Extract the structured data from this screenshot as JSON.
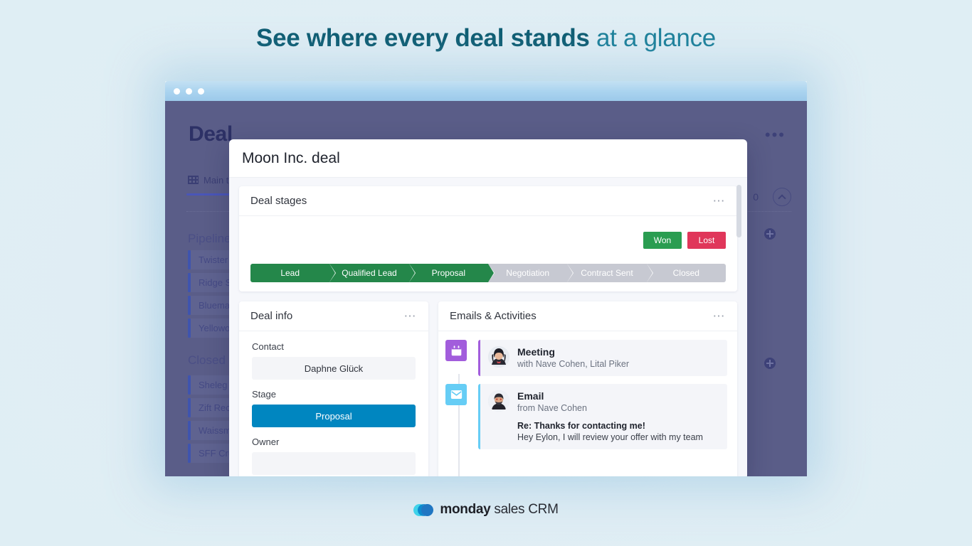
{
  "headline": {
    "strong": "See where every deal stands",
    "light": " at a glance"
  },
  "window": {
    "titlebar_dots": 3
  },
  "board": {
    "title": "Deal",
    "menu_icon": "kebab-menu-icon",
    "tab": {
      "icon": "table-grid-icon",
      "label": "Main t"
    },
    "count": "0",
    "collapse_icon": "chevron-up-icon",
    "groups": [
      {
        "label": "Pipeline",
        "rows": [
          {
            "label": "Twister"
          },
          {
            "label": "Ridge S"
          },
          {
            "label": "Bluema"
          },
          {
            "label": "Yellowo"
          }
        ]
      },
      {
        "label": "Closed ",
        "rows": [
          {
            "label": "Sheleg "
          },
          {
            "label": "Zift Rec"
          },
          {
            "label": "Waissm"
          },
          {
            "label": "SFF Cru"
          }
        ]
      }
    ],
    "add_row_icon": "plus-circle-icon"
  },
  "modal": {
    "title": "Moon Inc. deal",
    "deal_stages": {
      "title": "Deal stages",
      "kebab": "⋯",
      "won_label": "Won",
      "lost_label": "Lost",
      "won_color": "#2a9d51",
      "lost_color": "#e0365a",
      "active_color": "#24874a",
      "inactive_color": "#c7c9d2",
      "stages": [
        {
          "label": "Lead",
          "state": "done"
        },
        {
          "label": "Qualified Lead",
          "state": "done"
        },
        {
          "label": "Proposal",
          "state": "done"
        },
        {
          "label": "Negotiation",
          "state": "todo"
        },
        {
          "label": "Contract Sent",
          "state": "todo"
        },
        {
          "label": "Closed",
          "state": "todo"
        }
      ]
    },
    "deal_info": {
      "title": "Deal info",
      "kebab": "⋯",
      "fields": [
        {
          "label": "Contact",
          "value": "Daphne Glück",
          "style": "plain"
        },
        {
          "label": "Stage",
          "value": "Proposal",
          "style": "blue"
        },
        {
          "label": "Owner",
          "value": "",
          "style": "plain"
        }
      ],
      "stage_color": "#0086c0"
    },
    "emails": {
      "title": "Emails & Activities",
      "kebab": "⋯",
      "items": [
        {
          "icon": "calendar-icon",
          "icon_color": "#a25ddc",
          "type": "Meeting",
          "subtitle": "with Nave Cohen, Lital Piker",
          "avatar": "avatar-woman"
        },
        {
          "icon": "envelope-icon",
          "icon_color": "#66cdf5",
          "type": "Email",
          "subtitle": "from Nave Cohen",
          "avatar": "avatar-man",
          "mail_subject": "Re: Thanks for contacting me!",
          "mail_body": "Hey Eylon, I will review your offer with my team"
        }
      ]
    }
  },
  "logo": {
    "brand": "monday",
    "product": " sales CRM"
  }
}
